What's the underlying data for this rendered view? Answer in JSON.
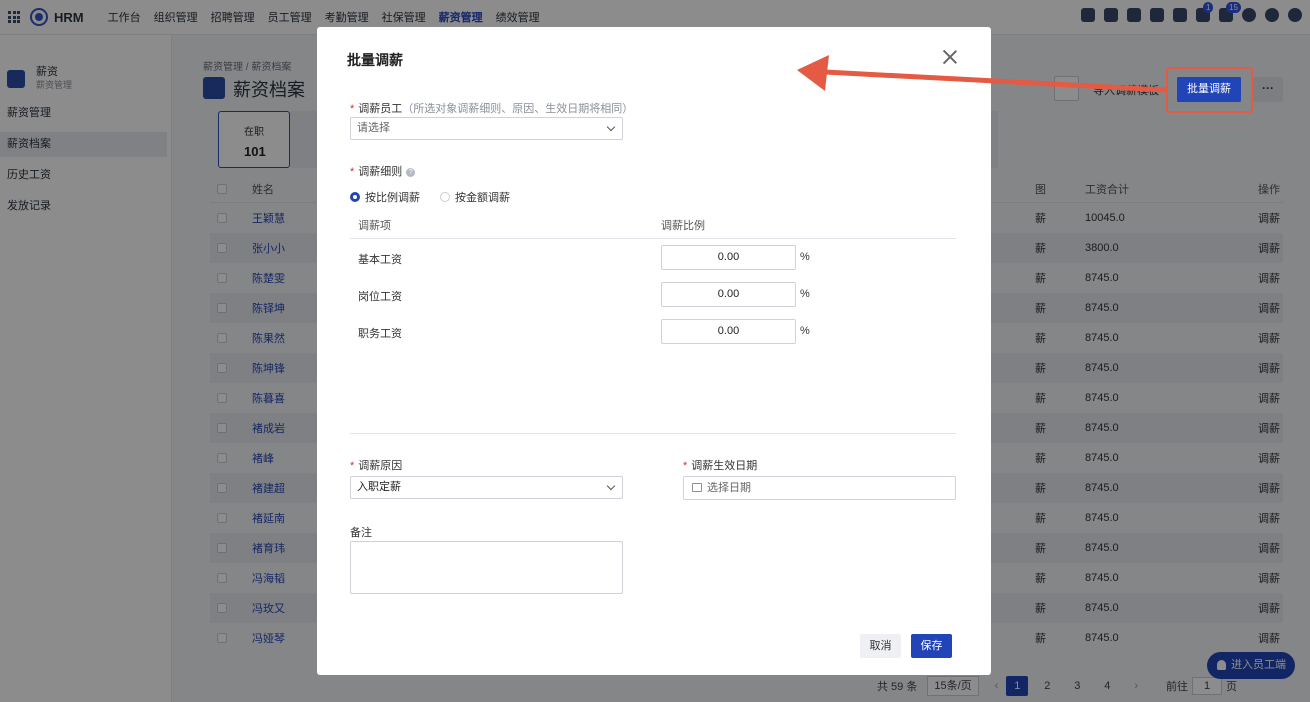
{
  "topbar": {
    "brand": "HRM",
    "nav": [
      "工作台",
      "组织管理",
      "招聘管理",
      "员工管理",
      "考勤管理",
      "社保管理",
      "薪资管理",
      "绩效管理"
    ],
    "active_nav": "薪资管理",
    "badges": {
      "flag": "1",
      "bell": "15"
    }
  },
  "sidebar": {
    "title": "薪资",
    "subtitle": "薪资管理",
    "items": [
      {
        "label": "薪资管理"
      },
      {
        "label": "薪资档案"
      },
      {
        "label": "历史工资"
      },
      {
        "label": "发放记录"
      }
    ],
    "active": "薪资档案"
  },
  "page": {
    "breadcrumb": "薪资管理  /  薪资档案",
    "title": "薪资档案",
    "stat_label": "在职",
    "stat_value": "101",
    "toolbar_text": "导入调薪模板",
    "batch_button": "批量调薪",
    "more_button": "···"
  },
  "table": {
    "headers": {
      "name": "姓名",
      "partial": "图",
      "total": "工资合计",
      "op": "操作"
    },
    "rows": [
      {
        "name": "王颖慧",
        "x": "薪",
        "total": "10045.0",
        "op": "调薪"
      },
      {
        "name": "张小小",
        "x": "薪",
        "total": "3800.0",
        "op": "调薪"
      },
      {
        "name": "陈楚雯",
        "x": "薪",
        "total": "8745.0",
        "op": "调薪"
      },
      {
        "name": "陈铎坤",
        "x": "薪",
        "total": "8745.0",
        "op": "调薪"
      },
      {
        "name": "陈果然",
        "x": "薪",
        "total": "8745.0",
        "op": "调薪"
      },
      {
        "name": "陈坤锋",
        "x": "薪",
        "total": "8745.0",
        "op": "调薪"
      },
      {
        "name": "陈暮喜",
        "x": "薪",
        "total": "8745.0",
        "op": "调薪"
      },
      {
        "name": "褚成岩",
        "x": "薪",
        "total": "8745.0",
        "op": "调薪"
      },
      {
        "name": "褚峰",
        "x": "薪",
        "total": "8745.0",
        "op": "调薪"
      },
      {
        "name": "褚建超",
        "x": "薪",
        "total": "8745.0",
        "op": "调薪"
      },
      {
        "name": "褚延南",
        "x": "薪",
        "total": "8745.0",
        "op": "调薪"
      },
      {
        "name": "褚育玮",
        "x": "薪",
        "total": "8745.0",
        "op": "调薪"
      },
      {
        "name": "冯海韬",
        "x": "薪",
        "total": "8745.0",
        "op": "调薪"
      },
      {
        "name": "冯玫又",
        "x": "薪",
        "total": "8745.0",
        "op": "调薪"
      },
      {
        "name": "冯娅琴",
        "x": "薪",
        "total": "8745.0",
        "op": "调薪"
      }
    ]
  },
  "pager": {
    "total": "共 59 条",
    "page_size": "15条/页",
    "pages": [
      "1",
      "2",
      "3",
      "4"
    ],
    "current": "1",
    "goto_label": "前往",
    "goto_value": "1",
    "goto_suffix": "页"
  },
  "employee_portal_button": "进入员工端",
  "modal": {
    "title": "批量调薪",
    "employee_label": "调薪员工",
    "employee_hint": "（所选对象调薪细则、原因、生效日期将相同）",
    "employee_placeholder": "请选择",
    "rule_label": "调薪细则",
    "radio_ratio": "按比例调薪",
    "radio_amount": "按金额调薪",
    "selected_mode": "按比例调薪",
    "col_item": "调薪项",
    "col_ratio": "调薪比例",
    "items": [
      {
        "name": "基本工资",
        "value": "0.00",
        "unit": "%"
      },
      {
        "name": "岗位工资",
        "value": "0.00",
        "unit": "%"
      },
      {
        "name": "职务工资",
        "value": "0.00",
        "unit": "%"
      }
    ],
    "reason_label": "调薪原因",
    "reason_value": "入职定薪",
    "date_label": "调薪生效日期",
    "date_placeholder": "选择日期",
    "remark_label": "备注",
    "cancel": "取消",
    "save": "保存"
  },
  "colors": {
    "primary": "#2145b9",
    "annotation": "#e45a44",
    "required": "#d4312f"
  }
}
